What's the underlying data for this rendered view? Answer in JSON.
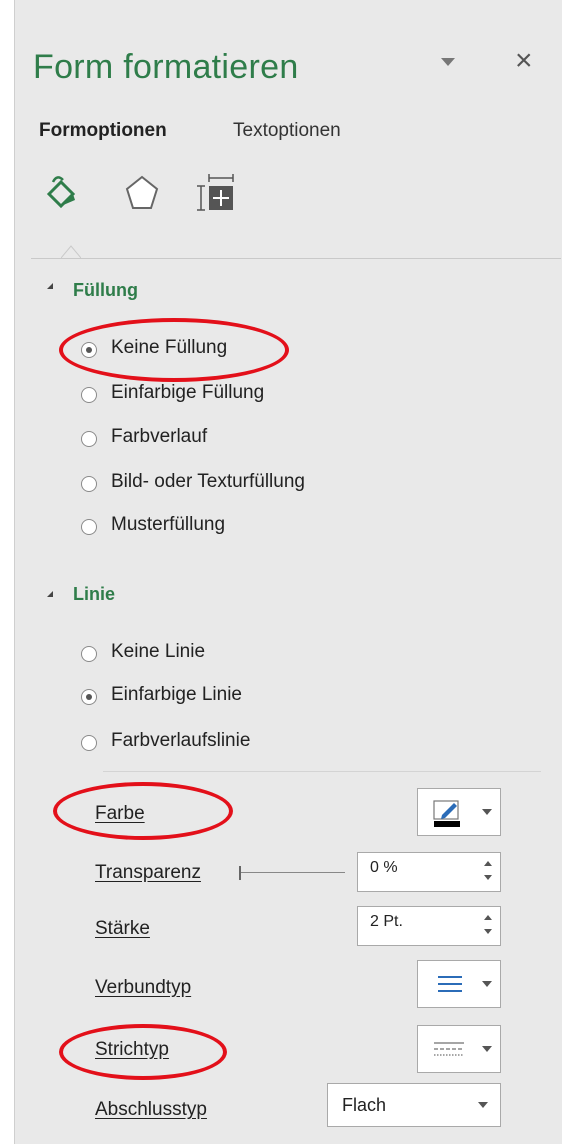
{
  "header": {
    "title": "Form formatieren"
  },
  "tabs": [
    {
      "label": "Formoptionen",
      "active": true
    },
    {
      "label": "Textoptionen",
      "active": false
    }
  ],
  "icon_tabs": [
    "paint-bucket-icon",
    "pentagon-icon",
    "size-properties-icon"
  ],
  "fill": {
    "heading": "Füllung",
    "options": [
      {
        "label": "Keine Füllung",
        "selected": true
      },
      {
        "label": "Einfarbige Füllung",
        "selected": false
      },
      {
        "label": "Farbverlauf",
        "selected": false
      },
      {
        "label": "Bild- oder Texturfüllung",
        "selected": false
      },
      {
        "label": "Musterfüllung",
        "selected": false
      }
    ]
  },
  "line": {
    "heading": "Linie",
    "options": [
      {
        "label": "Keine Linie",
        "selected": false
      },
      {
        "label": "Einfarbige Linie",
        "selected": true
      },
      {
        "label": "Farbverlaufslinie",
        "selected": false
      }
    ],
    "properties": {
      "color_label": "Farbe",
      "color_value": "#000000",
      "transparency_label": "Transparenz",
      "transparency_value": "0 %",
      "width_label": "Stärke",
      "width_value": "2 Pt.",
      "compound_label": "Verbundtyp",
      "dash_label": "Strichtyp",
      "cap_label": "Abschlusstyp",
      "cap_value": "Flach"
    }
  },
  "colors": {
    "accent_green": "#2f7d4a",
    "highlight_red": "#e3101a",
    "icon_blue": "#2b6cb8"
  }
}
